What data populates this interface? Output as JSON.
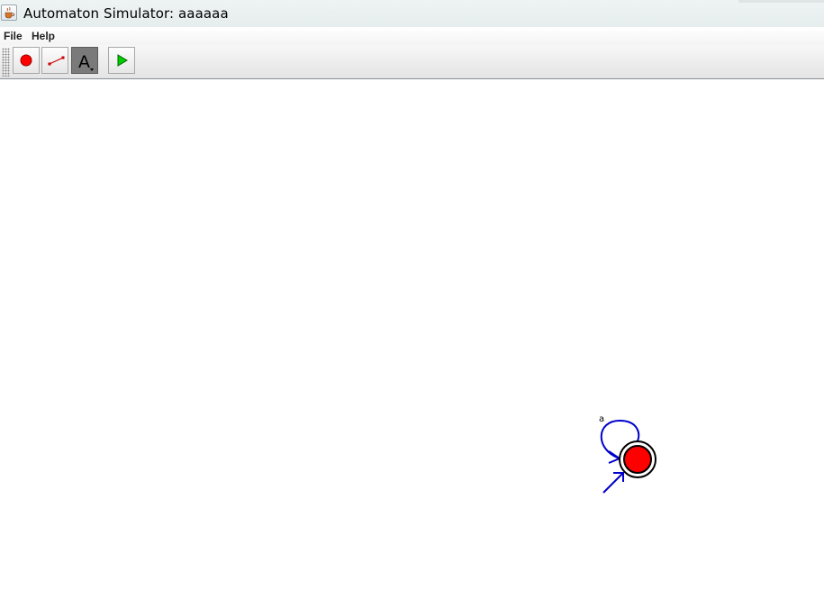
{
  "window": {
    "title": "Automaton Simulator: aaaaaa",
    "icon": "java-cup-icon"
  },
  "menu": {
    "items": [
      "File",
      "Help"
    ]
  },
  "toolbar": {
    "tools": [
      {
        "name": "add-state-tool",
        "icon": "red-circle-icon"
      },
      {
        "name": "add-transition-tool",
        "icon": "transition-line-icon"
      },
      {
        "name": "text-tool",
        "icon": "text-a-icon",
        "label": "A",
        "selected": true
      },
      {
        "name": "run-simulation-tool",
        "icon": "play-icon"
      }
    ]
  },
  "automaton": {
    "states": [
      {
        "accepting": true,
        "initial": true,
        "color": "#ff0000"
      }
    ],
    "transitions": [
      {
        "label": "a",
        "type": "self-loop"
      }
    ],
    "colors": {
      "transition": "#0000cc",
      "state_fill": "#ff0000"
    }
  }
}
